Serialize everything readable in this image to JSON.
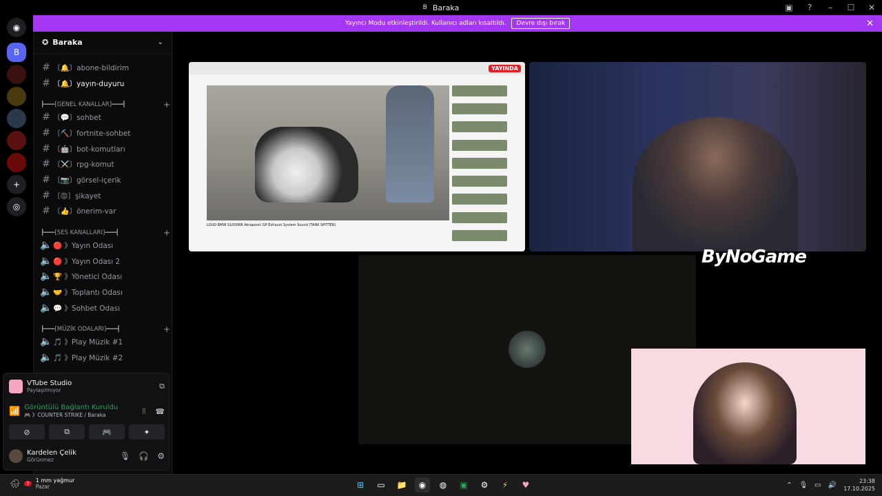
{
  "window": {
    "title": "Baraka",
    "app_letter": "B"
  },
  "banner": {
    "text": "Yayıncı Modu etkinleştirildi. Kullanıcı adları kısaltıldı.",
    "button": "Devre dışı bırak"
  },
  "server": {
    "name": "Baraka",
    "channels_top": [
      {
        "label": "〔🔔〕abone-bildirim"
      },
      {
        "label": "〔🔔〕yayın-duyuru"
      }
    ],
    "categories": [
      "┣━━━[GENEL KANALLAR]━━━┫",
      "┣━━━[SES KANALLARI]━━━┫",
      "┣━━━[MÜZİK ODALARI]━━━┫"
    ],
    "general": [
      {
        "label": "〔💬〕sohbet"
      },
      {
        "label": "〔⛏️〕fortnite-sohbet"
      },
      {
        "label": "〔🤖〕bot-komutları"
      },
      {
        "label": "〔⚔️〕rpg-komut"
      },
      {
        "label": "〔📷〕görsel-içerik"
      },
      {
        "label": "〔😡〕şikayet"
      },
      {
        "label": "〔👍〕önerim-var"
      }
    ],
    "voice": [
      {
        "label": "🔴 》Yayın Odası"
      },
      {
        "label": "🔴 》Yayın Odası 2"
      },
      {
        "label": "🏆 》Yönetici Odası"
      },
      {
        "label": "🤝 》Toplantı Odası"
      },
      {
        "label": "💬 》Sohbet Odası"
      }
    ],
    "music": [
      {
        "label": "🎵 》Play Müzik #1"
      },
      {
        "label": "🎵 》Play Müzik #2"
      }
    ]
  },
  "panel": {
    "vtube_name": "VTube Studio",
    "vtube_status": "Paylaşılmıyor",
    "conn_title": "Görüntülü Bağlantı Kuruldu",
    "conn_sub": "🎮 》COUNTER STRIKE / Baraka",
    "user_name": "Kardelen Çelik",
    "user_status": "Görünmez"
  },
  "stage": {
    "live_badge": "YAYINDA",
    "video_title": "LOUD BMW S1000RR Akrapovič GP Exhaust System Sound (TANK SPITTER)",
    "brand": "ByNoGame"
  },
  "taskbar": {
    "weather_line1": "1 mm yağmur",
    "weather_line2": "Pazar",
    "weather_badge": "7",
    "time": "23:38",
    "date": "17.10.2025"
  },
  "colors": {
    "banner": "#a437f1",
    "connected": "#23a55a",
    "live": "#e31b23"
  }
}
